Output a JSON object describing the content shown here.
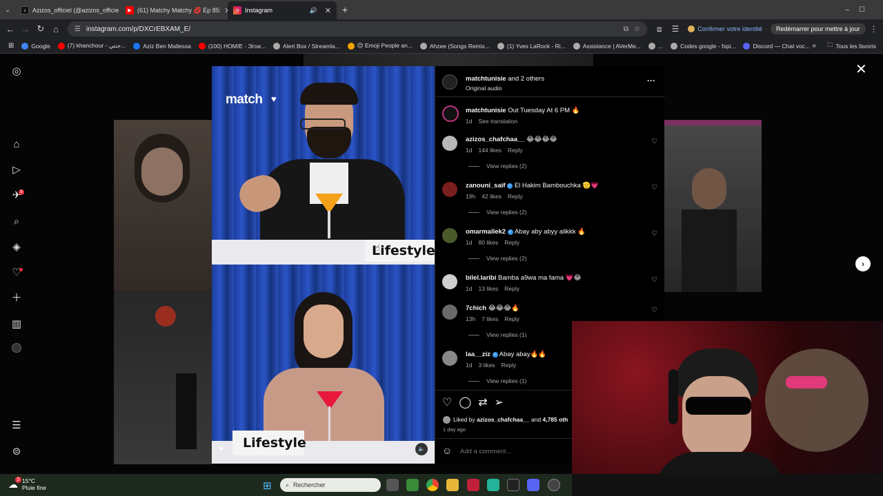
{
  "browser": {
    "tabs": [
      {
        "title": "Azizos_officiel (@azizos_officie",
        "icon": "tiktok-icon",
        "color": "#111111",
        "active": false
      },
      {
        "title": "(61) Matchy Matchy 💋 Ep 85:",
        "icon": "youtube-icon",
        "color": "#ff0000",
        "active": false
      },
      {
        "title": "Instagram",
        "icon": "instagram-icon",
        "color": "#d6249f",
        "active": true
      }
    ],
    "new_tab": "+",
    "url": "instagram.com/p/DXCrEBXAM_E/",
    "identity": "Confirmer votre identité",
    "restart": "Redémarrer pour mettre à jour",
    "bookmarks": [
      {
        "label": "Google",
        "color": "#4285f4"
      },
      {
        "label": "(7) khanchour - جنتي...",
        "color": "#ff0000"
      },
      {
        "label": "Aziz Ben Mallessa",
        "color": "#1877f2"
      },
      {
        "label": "(100) HOMIE - Эгои...",
        "color": "#ff0000"
      },
      {
        "label": "Alert Box / Streamla...",
        "color": "#aaaaaa"
      },
      {
        "label": "😊 Emoji People an...",
        "color": "#f4a300"
      },
      {
        "label": "Ahzee (Songs Remix...",
        "color": "#aaaaaa"
      },
      {
        "label": "(1) Yves LaRock - Ri...",
        "color": "#aaaaaa"
      },
      {
        "label": "Assistance | AVerMe...",
        "color": "#aaaaaa"
      },
      {
        "label": "...",
        "color": "#aaaaaa"
      },
      {
        "label": "Codes google - fxpi...",
        "color": "#aaaaaa"
      },
      {
        "label": "Discord — Chat voc...",
        "color": "#5865f2"
      }
    ],
    "all_bookmarks": "Tous les favoris"
  },
  "rail": {
    "notif_badge": "5"
  },
  "post": {
    "header": {
      "user": "matchtunisie",
      "coauthors": " and 2 others",
      "audio": "Original audio",
      "more": "···"
    },
    "caption": {
      "user": "matchtunisie",
      "text": " Out Tuesday At 6 PM 🔥",
      "time": "1d",
      "translate": "See translation"
    },
    "media": {
      "brand": "match",
      "label_top": "Lifestyle",
      "label_bottom": "Lifestyle"
    },
    "comments": [
      {
        "user": "azizos_chafchaa__",
        "verified": false,
        "text": " 😂😂😂😂",
        "time": "1d",
        "likes": "144 likes",
        "reply": "Reply",
        "replies": "View replies (2)",
        "avatar_color": "#b8b8b8"
      },
      {
        "user": "zanouni_saif",
        "verified": true,
        "text": " El Hakim Bambouchka 🫡💗",
        "time": "19h",
        "likes": "42 likes",
        "reply": "Reply",
        "replies": "View replies (2)",
        "avatar_color": "#7a1e1e"
      },
      {
        "user": "omarmallek2",
        "verified": true,
        "text": " Abay aby abyy alikkk 🔥",
        "time": "1d",
        "likes": "80 likes",
        "reply": "Reply",
        "replies": "View replies (2)",
        "avatar_color": "#4a5a2a"
      },
      {
        "user": "bilel.laribi",
        "verified": false,
        "text": " Bamba a9wa ma fama 💗😂",
        "time": "1d",
        "likes": "13 likes",
        "reply": "Reply",
        "replies": "",
        "avatar_color": "#cfcfcf"
      },
      {
        "user": "7chich",
        "verified": false,
        "text": " 😂😂😂🔥",
        "time": "13h",
        "likes": "7 likes",
        "reply": "Reply",
        "replies": "View replies (1)",
        "avatar_color": "#6a6a6a"
      },
      {
        "user": "laa__ziz",
        "verified": true,
        "text": " Abay abay🔥🔥",
        "time": "1d",
        "likes": "3 likes",
        "reply": "Reply",
        "replies": "View replies (1)",
        "avatar_color": "#888888"
      }
    ],
    "liked_by": {
      "prefix": "Liked by ",
      "user": "azizos_chafchaa__",
      "suffix": " and ",
      "count": "4,785 oth"
    },
    "posted": "1 day ago",
    "comment_placeholder": "Add a comment..."
  },
  "taskbar": {
    "weather_badge": "2",
    "temperature": "15°C",
    "condition": "Pluie fine",
    "search_placeholder": "Rechercher"
  }
}
